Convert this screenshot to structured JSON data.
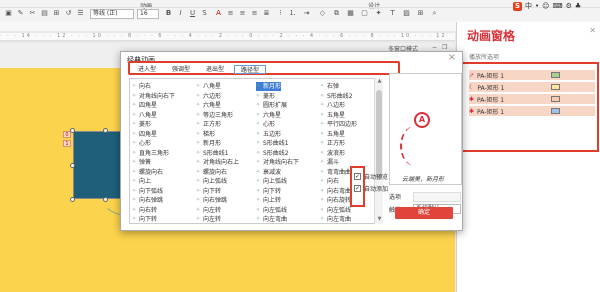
{
  "ribbon": {
    "group_animation": "动画",
    "group_design": "设计",
    "font_name": "等线 (正)",
    "font_size": "16",
    "ime_text": "中"
  },
  "ruler_text": "· · · 14 · · · 12 · · · 10 · · · 8 · · · 6 · · · 4 · · · 2 · · · 0 · · · 2 · · · 4 · · · 6 · · · 8 · · · 10 · · · 12",
  "canvas": {
    "tag1": "0",
    "tag2": "1",
    "multi_window": "多窗口模式"
  },
  "dialog": {
    "title": "经典动画",
    "tabs": [
      {
        "label": "进入型",
        "active": false
      },
      {
        "label": "强调型",
        "active": false
      },
      {
        "label": "退出型",
        "active": false
      },
      {
        "label": "路径型",
        "active": true
      }
    ],
    "grid": [
      [
        "向右",
        "八角星",
        "新月形",
        "右弹"
      ],
      [
        "对角线向右下",
        "六边形",
        "菱形",
        "S形曲线2"
      ],
      [
        "四角星",
        "六角星",
        "圆形扩展",
        "八边形"
      ],
      [
        "八角星",
        "等边三角形",
        "六角星",
        "五角星"
      ],
      [
        "菱形",
        "正方形",
        "心形",
        "平行四边形"
      ],
      [
        "四角星",
        "梯形",
        "五边形",
        "五角星"
      ],
      [
        "心形",
        "新月形",
        "S形曲线1",
        "正方形"
      ],
      [
        "直角三角形",
        "S形曲线1",
        "S形曲线2",
        "波浪形"
      ],
      [
        "弹簧",
        "对角线向右上",
        "对角线向右下",
        "漏斗"
      ],
      [
        "螺旋向右",
        "螺旋向右",
        "衰减波",
        "弯弯曲曲"
      ],
      [
        "向上",
        "向上弧线",
        "向上弧线",
        "向右"
      ],
      [
        "向下弧线",
        "向下转",
        "向下转",
        "向右弯曲"
      ],
      [
        "向右弹跳",
        "向右弹跳",
        "向上转",
        "向右旋转"
      ],
      [
        "向右转",
        "向左转",
        "向左弧线",
        "向左弧线"
      ],
      [
        "向下转",
        "向左转",
        "向左弯曲",
        "向左弯曲"
      ]
    ],
    "selected_cell": "新月形",
    "preview_caption": "云端美，新月形",
    "option_label": "选项",
    "speed_label": "触发:",
    "speed_value": "系统默认",
    "check_autopreview": "自动预览",
    "check_autoadd": "自动添加",
    "ok_label": "确定"
  },
  "pane": {
    "title": "动画窗格",
    "toolbar": "播放所选项",
    "items": [
      {
        "label": "PA-矩形 1",
        "color": "#a9d18e"
      },
      {
        "label": "PA-矩形 1",
        "color": "#ffe699"
      },
      {
        "label": "PA-矩形 1",
        "color": "#f8cbad"
      },
      {
        "label": "PA-矩形 1",
        "color": "#9dc3e6"
      }
    ]
  },
  "colors": {
    "accent_red": "#e23c2a",
    "slide_yellow": "#fcd34d",
    "shape_teal": "#1f5f7a",
    "selection_blue": "#3d7fd6"
  }
}
